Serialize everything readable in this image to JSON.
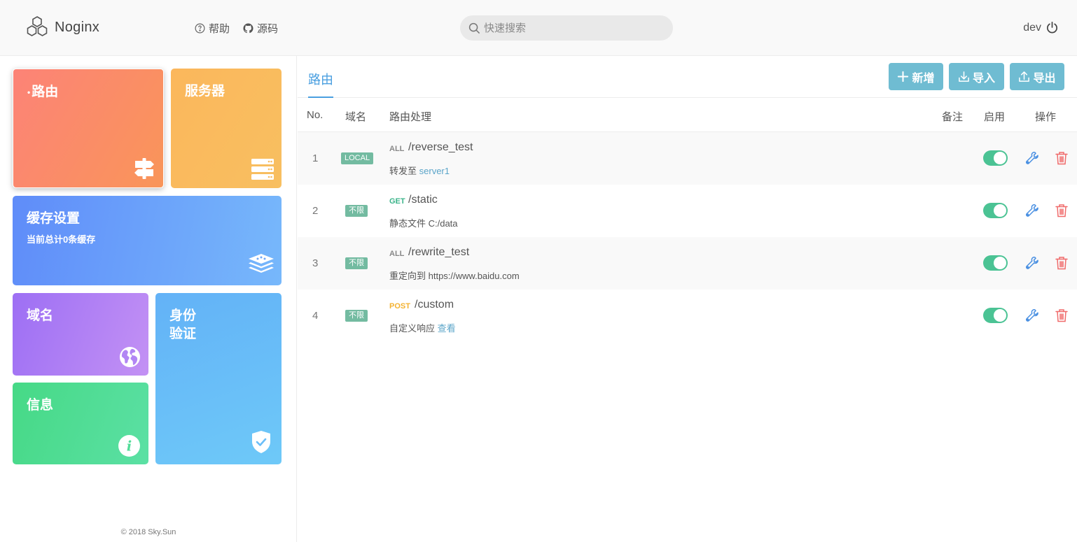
{
  "header": {
    "app_name": "Noginx",
    "help_label": "帮助",
    "source_label": "源码",
    "search_placeholder": "快速搜索",
    "username": "dev"
  },
  "sidebar": {
    "tiles": {
      "route": {
        "title": "路由",
        "icon": "signpost-icon"
      },
      "server": {
        "title": "服务器",
        "icon": "server-icon"
      },
      "cache": {
        "title": "缓存设置",
        "subtitle": "当前总计0条缓存",
        "icon": "layers-icon"
      },
      "domain": {
        "title": "域名",
        "icon": "globe-icon"
      },
      "auth": {
        "title_line1": "身份",
        "title_line2": "验证",
        "icon": "shield-check-icon"
      },
      "info": {
        "title": "信息",
        "icon": "info-icon"
      }
    },
    "copyright": "© 2018 Sky.Sun"
  },
  "main": {
    "tab": "路由",
    "buttons": {
      "add": "新增",
      "import": "导入",
      "export": "导出"
    },
    "columns": {
      "no": "No.",
      "domain": "域名",
      "handler": "路由处理",
      "note": "备注",
      "enabled": "启用",
      "actions": "操作"
    },
    "rows": [
      {
        "no": "1",
        "domain": "LOCAL",
        "method": "ALL",
        "path": "/reverse_test",
        "desc": "转发至",
        "desc_link": "server1",
        "enabled": true
      },
      {
        "no": "2",
        "domain": "不限",
        "method": "GET",
        "path": "/static",
        "desc": "静态文件 C:/data",
        "desc_link": "",
        "enabled": true
      },
      {
        "no": "3",
        "domain": "不限",
        "method": "ALL",
        "path": "/rewrite_test",
        "desc": "重定向到 https://www.baidu.com",
        "desc_link": "",
        "enabled": true
      },
      {
        "no": "4",
        "domain": "不限",
        "method": "POST",
        "path": "/custom",
        "desc": "自定义响应",
        "desc_link": "查看",
        "enabled": true
      }
    ]
  },
  "colors": {
    "accent": "#4a9fe0",
    "button": "#6fbcd2",
    "toggle_on": "#4bc394",
    "delete": "#f06b6b"
  }
}
